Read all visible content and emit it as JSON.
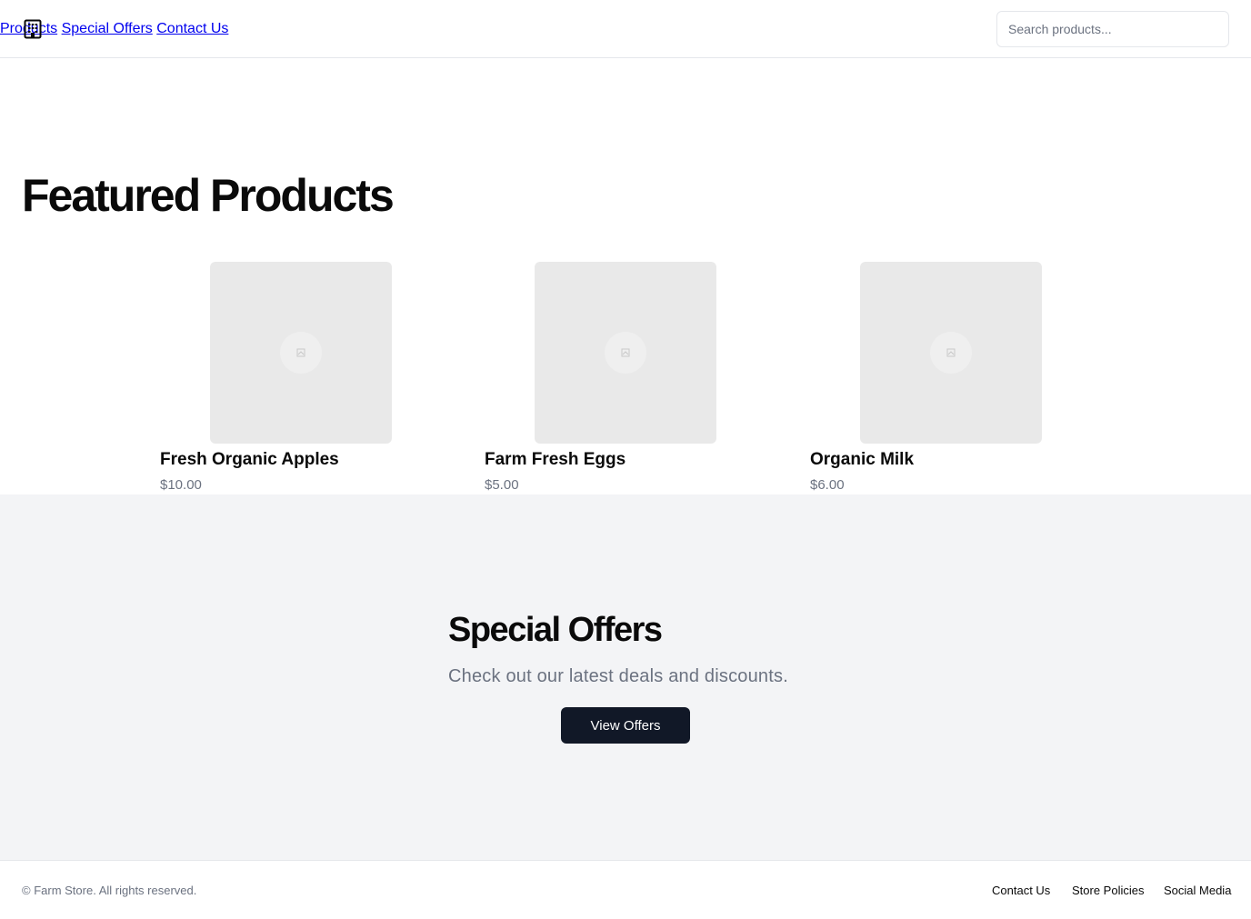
{
  "header": {
    "logo_icon": "building-icon",
    "nav": [
      {
        "label": "Products"
      },
      {
        "label": "Special Offers"
      },
      {
        "label": "Contact Us"
      }
    ],
    "search": {
      "placeholder": "Search products...",
      "value": ""
    }
  },
  "featured": {
    "title": "Featured Products",
    "products": [
      {
        "name": "Fresh Organic Apples",
        "price": "$10.00",
        "image_icon": "image-placeholder-icon"
      },
      {
        "name": "Farm Fresh Eggs",
        "price": "$5.00",
        "image_icon": "image-placeholder-icon"
      },
      {
        "name": "Organic Milk",
        "price": "$6.00",
        "image_icon": "image-placeholder-icon"
      }
    ]
  },
  "offers": {
    "title": "Special Offers",
    "subtitle": "Check out our latest deals and discounts.",
    "button_label": "View Offers"
  },
  "footer": {
    "copyright": "© Farm Store. All rights reserved.",
    "links": [
      {
        "label": "Contact Us"
      },
      {
        "label": "Store Policies"
      },
      {
        "label": "Social Media"
      }
    ]
  },
  "colors": {
    "primary_button": "#111827",
    "muted_text": "#6b7280",
    "section_bg": "#f3f4f6",
    "image_placeholder": "#e9e9e9",
    "border": "#e5e7eb"
  }
}
